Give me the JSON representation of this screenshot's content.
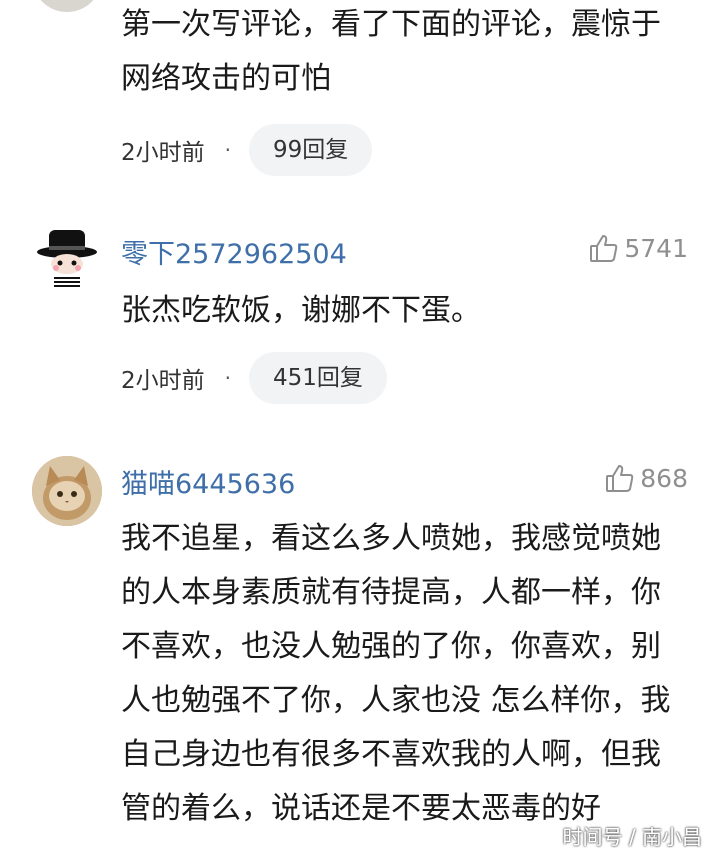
{
  "comments": [
    {
      "username": "",
      "likes": "",
      "lines": [
        "第一次写评论，看了下面的评论，震惊于",
        "网络攻击的可怕"
      ],
      "time": "2小时前",
      "replies": "99回复"
    },
    {
      "username": "零下2572962504",
      "likes": "5741",
      "avatar_icon": "black-hat-cartoon-avatar",
      "lines": [
        "张杰吃软饭，谢娜不下蛋。"
      ],
      "time": "2小时前",
      "replies": "451回复"
    },
    {
      "username": "猫喵6445636",
      "likes": "868",
      "avatar_icon": "cat-photo-avatar",
      "lines": [
        "我不追星，看这么多人喷她，我感觉喷她",
        "的人本身素质就有待提高，人都一样，你",
        "不喜欢，也没人勉强的了你，你喜欢，别",
        "人也勉强不了你，人家也没 怎么样你，我",
        "自己身边也有很多不喜欢我的人啊，但我",
        "管的着么，说话还是不要太恶毒的好"
      ]
    }
  ],
  "separator": "·",
  "watermark": "时间号 / 南小昌",
  "colors": {
    "username": "#3f6fa8",
    "like_count": "#8f8f8f",
    "reply_bg": "#f2f3f5"
  }
}
